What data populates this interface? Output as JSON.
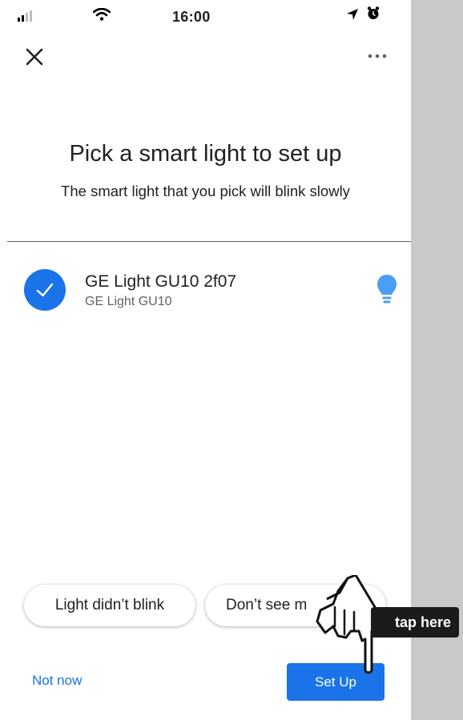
{
  "status_bar": {
    "time": "16:00"
  },
  "header": {
    "close_icon": "close-icon",
    "more_icon": "more-horiz-icon"
  },
  "page": {
    "title": "Pick a smart light to set up",
    "subtitle": "The smart light that you pick will blink slowly"
  },
  "device": {
    "name": "GE Light GU10 2f07",
    "model": "GE Light GU10",
    "selected": true,
    "icon": "lightbulb-icon",
    "icon_color": "#4a9ff5"
  },
  "actions": {
    "didnt_blink": "Light didn’t blink",
    "dont_see": "Don’t see m",
    "not_now": "Not now",
    "set_up": "Set Up"
  },
  "overlay": {
    "tap_label": "tap here",
    "icon": "pointing-hand-icon"
  },
  "colors": {
    "accent": "#1a73e8",
    "side_strip": "#c8c9cb"
  }
}
